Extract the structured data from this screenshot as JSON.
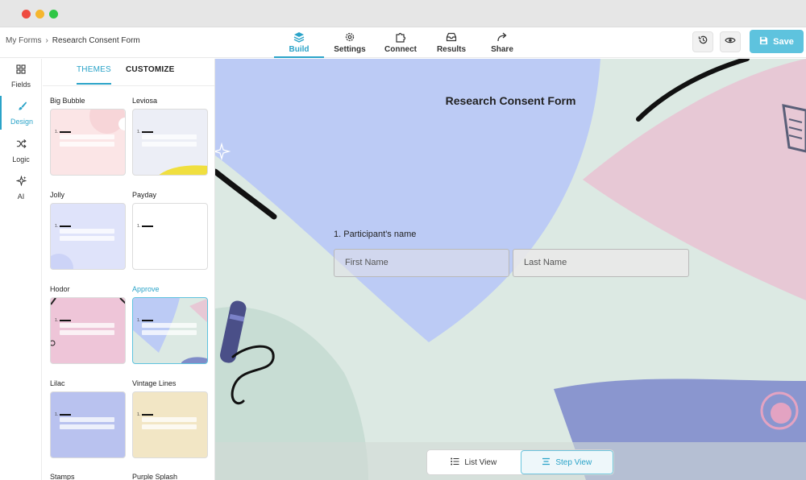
{
  "breadcrumb": {
    "parent": "My Forms",
    "separator": "›",
    "current": "Research Consent Form"
  },
  "nav": {
    "tabs": [
      {
        "label": "Build",
        "icon": "layers-icon",
        "active": true
      },
      {
        "label": "Settings",
        "icon": "gear-icon"
      },
      {
        "label": "Connect",
        "icon": "puzzle-icon"
      },
      {
        "label": "Results",
        "icon": "inbox-icon"
      },
      {
        "label": "Share",
        "icon": "share-arrow-icon"
      }
    ]
  },
  "toolbar": {
    "history_icon": "history-icon",
    "preview_icon": "eye-icon",
    "save_label": "Save"
  },
  "rail": {
    "items": [
      {
        "label": "Fields",
        "icon": "grid-icon"
      },
      {
        "label": "Design",
        "icon": "brush-icon",
        "active": true
      },
      {
        "label": "Logic",
        "icon": "shuffle-icon"
      },
      {
        "label": "AI",
        "icon": "sparkle-icon"
      }
    ]
  },
  "panel": {
    "tabs": {
      "themes": "THEMES",
      "customize": "CUSTOMIZE"
    },
    "themes": [
      {
        "name": "Big Bubble",
        "bg": "#fbe5e6"
      },
      {
        "name": "Leviosa",
        "bg": "#eceef6"
      },
      {
        "name": "Jolly",
        "bg": "#dfe3fa"
      },
      {
        "name": "Payday",
        "bg": "#ffffff"
      },
      {
        "name": "Hodor",
        "bg": "#eec5d8"
      },
      {
        "name": "Approve",
        "bg": "#dce9e3",
        "selected": true
      },
      {
        "name": "Lilac",
        "bg": "#b9c2ef"
      },
      {
        "name": "Vintage Lines",
        "bg": "#f2e6c5"
      },
      {
        "name": "Stamps",
        "bg": "#ffffff"
      },
      {
        "name": "Purple Splash",
        "bg": "#ffffff"
      }
    ],
    "thumb_number": "1."
  },
  "form": {
    "title": "Research Consent Form",
    "question": "1. Participant's name",
    "first_placeholder": "First Name",
    "last_placeholder": "Last Name"
  },
  "view_toggle": {
    "list": "List View",
    "step": "Step View",
    "active": "step"
  },
  "colors": {
    "accent": "#2aa3c8",
    "save": "#5ec3de",
    "canvas_bg": "#dce9e3",
    "blue_shape": "#bccbf5",
    "pink_shape": "#e7c8d5",
    "indigo_shape": "#7f8cc8"
  }
}
